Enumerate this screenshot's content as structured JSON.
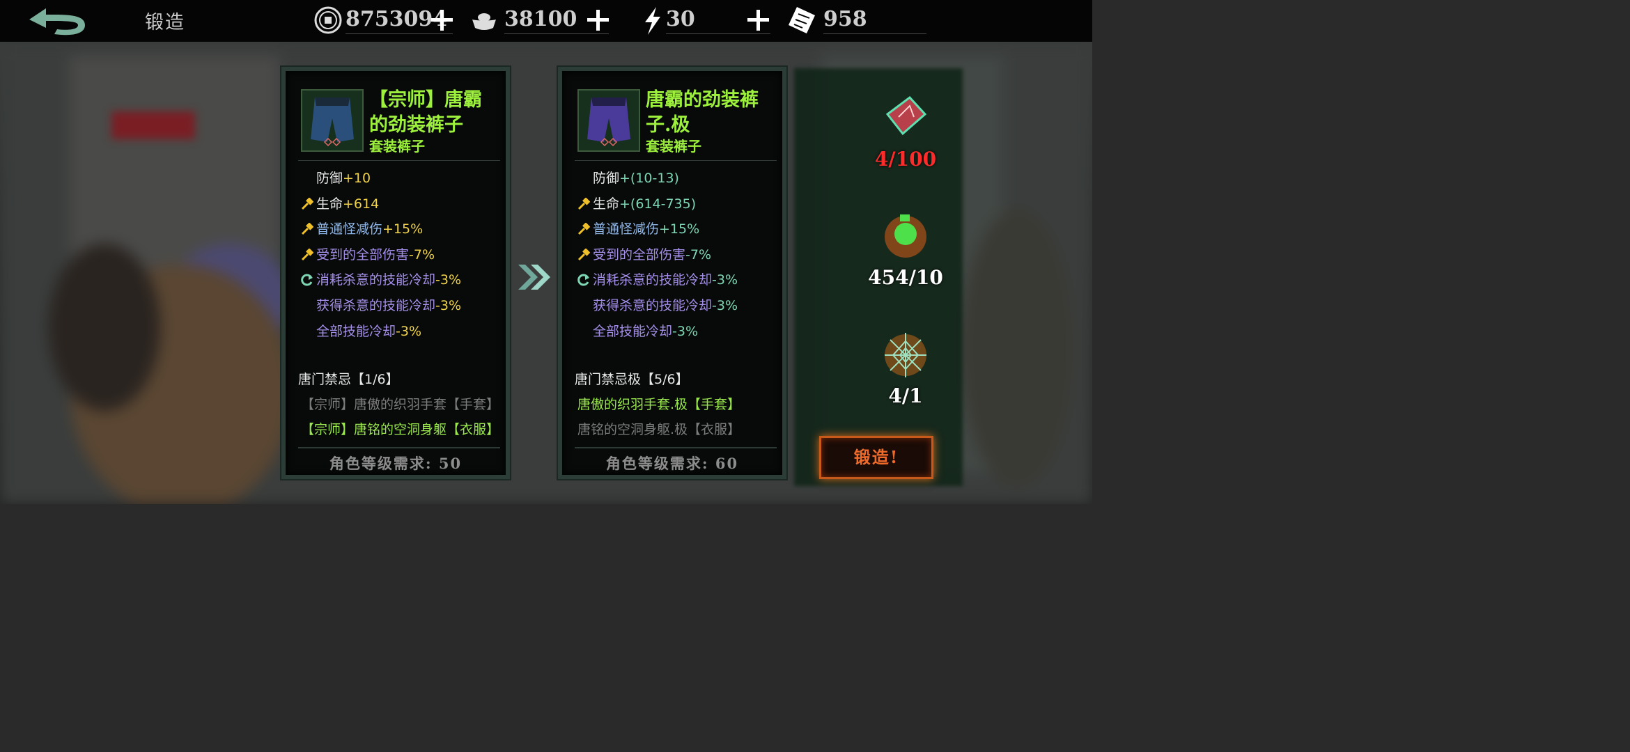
{
  "header": {
    "title": "锻造",
    "currencies": [
      {
        "icon": "coin-icon",
        "value": "8753094"
      },
      {
        "icon": "silver-ingot-icon",
        "value": "38100"
      },
      {
        "icon": "lightning-icon",
        "value": "30"
      },
      {
        "icon": "ticket-icon",
        "value": "958"
      }
    ]
  },
  "current_item": {
    "name_line1": "【宗师】唐霸",
    "name_line2": "的劲装裤子",
    "type": "套装裤子",
    "stats": [
      {
        "icon": "",
        "label": "防御",
        "value": "+10",
        "label_color": "white",
        "value_color": "yellow"
      },
      {
        "icon": "hammer-icon",
        "label": "生命",
        "value": "+614",
        "label_color": "white",
        "value_color": "yellow"
      },
      {
        "icon": "hammer-icon",
        "label": "普通怪减伤",
        "value": "+15%",
        "label_color": "blue",
        "value_color": "yellow"
      },
      {
        "icon": "hammer-icon",
        "label": "受到的全部伤害",
        "value": "-7%",
        "label_color": "purple",
        "value_color": "yellow"
      },
      {
        "icon": "refresh-icon",
        "label": "消耗杀意的技能冷却",
        "value": "-3%",
        "label_color": "purple",
        "value_color": "yellow"
      },
      {
        "icon": "",
        "label": "获得杀意的技能冷却",
        "value": "-3%",
        "label_color": "purple",
        "value_color": "yellow"
      },
      {
        "icon": "",
        "label": "全部技能冷却",
        "value": "-3%",
        "label_color": "purple",
        "value_color": "yellow"
      }
    ],
    "set_title": "唐门禁忌【1/6】",
    "set_items": [
      {
        "text": "【宗师】唐傲的织羽手套【手套】",
        "color": "gray"
      },
      {
        "text": "【宗师】唐铭的空洞身躯【衣服】",
        "color": "green"
      }
    ],
    "requirement_label": "角色等级需求:",
    "requirement_value": "50"
  },
  "forged_item": {
    "name_line1": "唐霸的劲装裤",
    "name_line2": "子.极",
    "type": "套装裤子",
    "stats": [
      {
        "icon": "",
        "label": "防御",
        "value": "+(10-13)",
        "label_color": "white",
        "value_color": "teal"
      },
      {
        "icon": "hammer-icon",
        "label": "生命",
        "value": "+(614-735)",
        "label_color": "white",
        "value_color": "teal"
      },
      {
        "icon": "hammer-icon",
        "label": "普通怪减伤",
        "value": "+15%",
        "label_color": "blue",
        "value_color": "teal"
      },
      {
        "icon": "hammer-icon",
        "label": "受到的全部伤害",
        "value": "-7%",
        "label_color": "purple",
        "value_color": "teal"
      },
      {
        "icon": "refresh-icon",
        "label": "消耗杀意的技能冷却",
        "value": "-3%",
        "label_color": "purple",
        "value_color": "teal"
      },
      {
        "icon": "",
        "label": "获得杀意的技能冷却",
        "value": "-3%",
        "label_color": "purple",
        "value_color": "teal"
      },
      {
        "icon": "",
        "label": "全部技能冷却",
        "value": "-3%",
        "label_color": "purple",
        "value_color": "teal"
      }
    ],
    "set_title": "唐门禁忌极【5/6】",
    "set_items": [
      {
        "text": "唐傲的织羽手套.极【手套】",
        "color": "green"
      },
      {
        "text": "唐铭的空洞身躯.极【衣服】",
        "color": "gray"
      }
    ],
    "requirement_label": "角色等级需求:",
    "requirement_value": "60"
  },
  "materials": [
    {
      "icon": "red-crystal-icon",
      "count": "4/100",
      "color": "#ff2a2a"
    },
    {
      "icon": "green-orb-icon",
      "count": "454/10",
      "color": "#ffffff"
    },
    {
      "icon": "spider-web-icon",
      "count": "4/1",
      "color": "#ffffff"
    }
  ],
  "forge_button": "锻造!",
  "colors": {
    "white": "#e6e6e6",
    "yellow": "#f0d24a",
    "teal": "#7fd6b4",
    "green": "#9ae64e",
    "blue": "#8fb6e8",
    "purple": "#a48ee8",
    "gray": "#7c7c7c"
  }
}
